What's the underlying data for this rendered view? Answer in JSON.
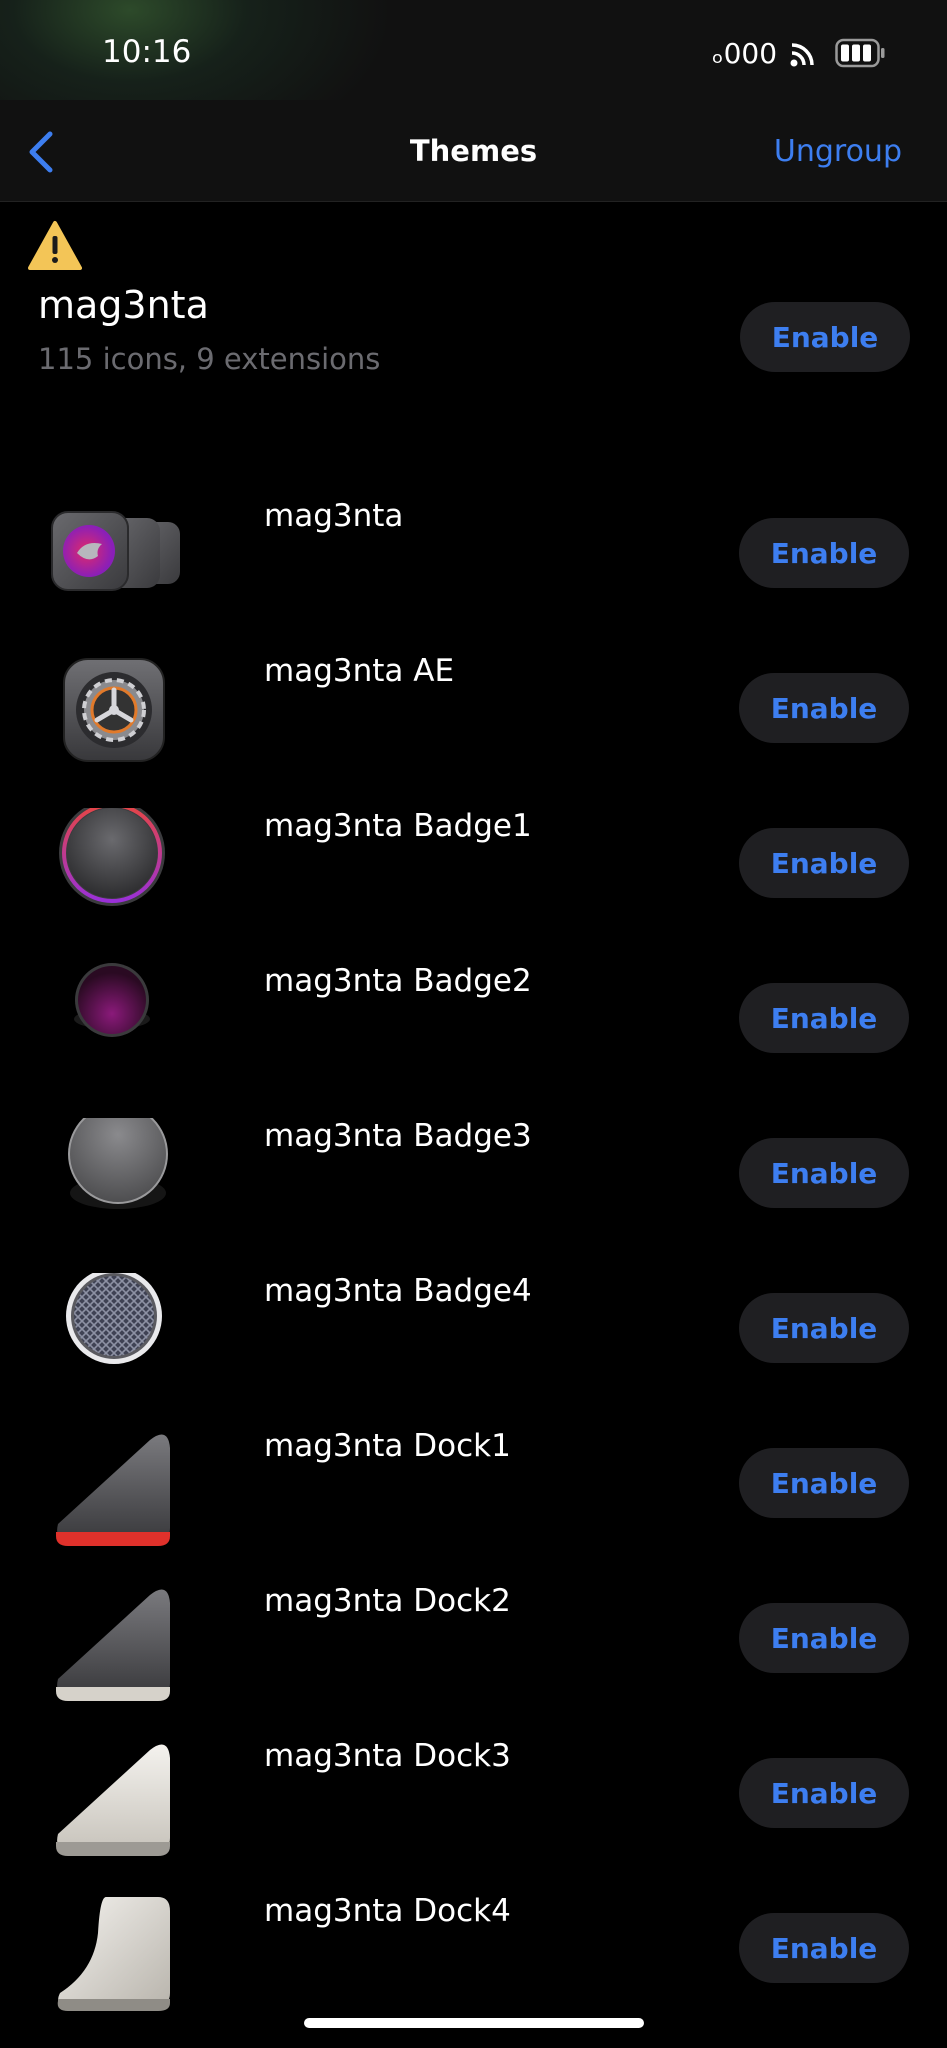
{
  "status": {
    "time": "10:16",
    "signal": "ₒ000"
  },
  "nav": {
    "title": "Themes",
    "ungroup": "Ungroup"
  },
  "group": {
    "title": "mag3nta",
    "subtitle": "115 icons, 9 extensions",
    "enable": "Enable"
  },
  "themes": [
    {
      "name": "mag3nta",
      "icon": "multi-icon-stack",
      "enable": "Enable"
    },
    {
      "name": "mag3nta AE",
      "icon": "settings-gear-icon",
      "enable": "Enable"
    },
    {
      "name": "mag3nta Badge1",
      "icon": "ring-badge-icon",
      "enable": "Enable"
    },
    {
      "name": "mag3nta Badge2",
      "icon": "purple-dot-badge-icon",
      "enable": "Enable"
    },
    {
      "name": "mag3nta Badge3",
      "icon": "grey-circle-badge-icon",
      "enable": "Enable"
    },
    {
      "name": "mag3nta Badge4",
      "icon": "mesh-circle-badge-icon",
      "enable": "Enable"
    },
    {
      "name": "mag3nta Dock1",
      "icon": "dark-dock-red-icon",
      "enable": "Enable"
    },
    {
      "name": "mag3nta Dock2",
      "icon": "dark-dock-icon",
      "enable": "Enable"
    },
    {
      "name": "mag3nta Dock3",
      "icon": "light-dock-icon",
      "enable": "Enable"
    },
    {
      "name": "mag3nta Dock4",
      "icon": "light-curved-dock-icon",
      "enable": "Enable"
    }
  ]
}
